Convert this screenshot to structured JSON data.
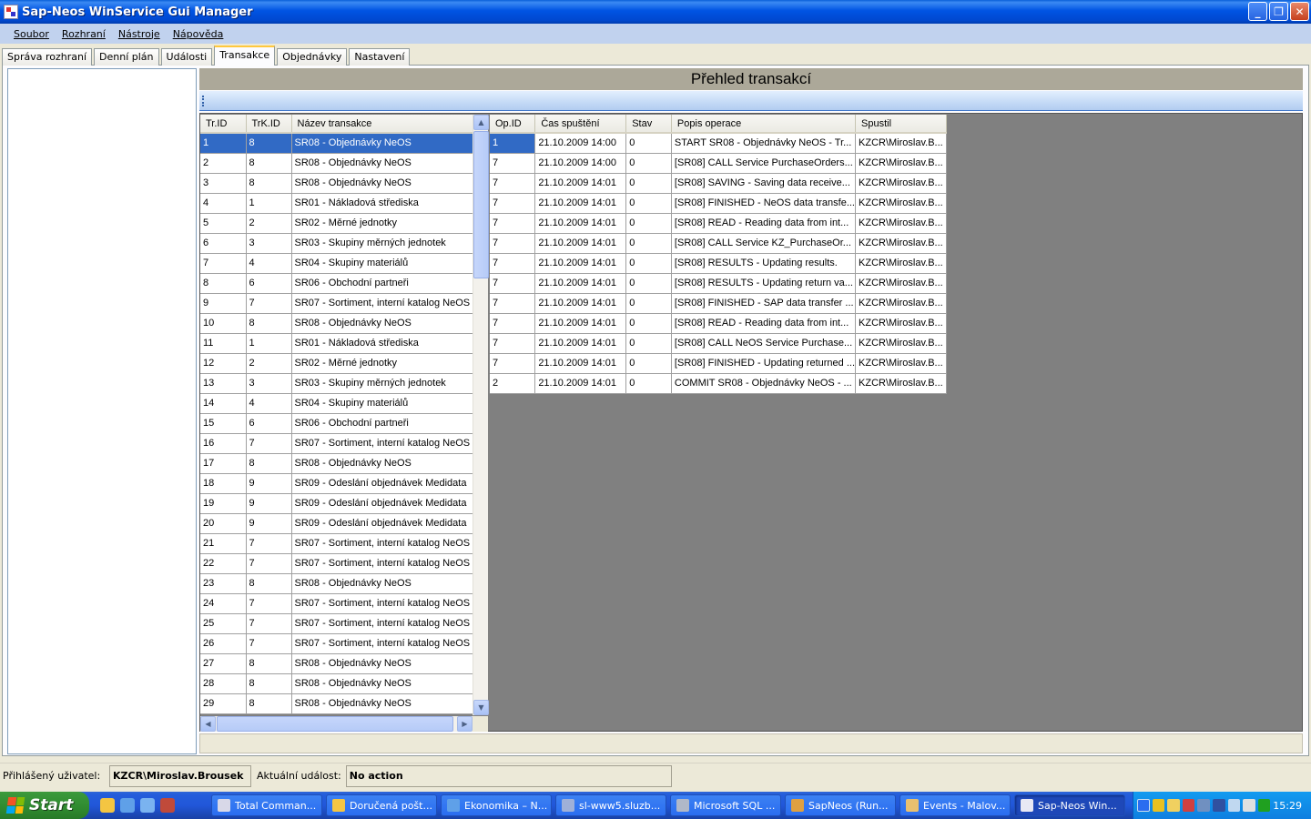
{
  "window": {
    "title": "Sap-Neos WinService Gui Manager"
  },
  "menu": [
    "Soubor",
    "Rozhraní",
    "Nástroje",
    "Nápověda"
  ],
  "tabs": [
    "Správa rozhraní",
    "Denní plán",
    "Události",
    "Transakce",
    "Objednávky",
    "Nastavení"
  ],
  "active_tab": "Transakce",
  "panel_title": "Přehled transakcí",
  "transactions": {
    "columns": [
      "Tr.ID",
      "TrK.ID",
      "Název transakce"
    ],
    "rows": [
      [
        "1",
        "8",
        "SR08 - Objednávky NeOS"
      ],
      [
        "2",
        "8",
        "SR08 - Objednávky NeOS"
      ],
      [
        "3",
        "8",
        "SR08 - Objednávky NeOS"
      ],
      [
        "4",
        "1",
        "SR01 - Nákladová střediska"
      ],
      [
        "5",
        "2",
        "SR02 - Měrné jednotky"
      ],
      [
        "6",
        "3",
        "SR03 - Skupiny měrných jednotek"
      ],
      [
        "7",
        "4",
        "SR04 - Skupiny materiálů"
      ],
      [
        "8",
        "6",
        "SR06 - Obchodní partneři"
      ],
      [
        "9",
        "7",
        "SR07 - Sortiment, interní katalog NeOS"
      ],
      [
        "10",
        "8",
        "SR08 - Objednávky NeOS"
      ],
      [
        "11",
        "1",
        "SR01 - Nákladová střediska"
      ],
      [
        "12",
        "2",
        "SR02 - Měrné jednotky"
      ],
      [
        "13",
        "3",
        "SR03 - Skupiny měrných jednotek"
      ],
      [
        "14",
        "4",
        "SR04 - Skupiny materiálů"
      ],
      [
        "15",
        "6",
        "SR06 - Obchodní partneři"
      ],
      [
        "16",
        "7",
        "SR07 - Sortiment, interní katalog NeOS"
      ],
      [
        "17",
        "8",
        "SR08 - Objednávky NeOS"
      ],
      [
        "18",
        "9",
        "SR09 - Odeslání objednávek Medidata"
      ],
      [
        "19",
        "9",
        "SR09 - Odeslání objednávek Medidata"
      ],
      [
        "20",
        "9",
        "SR09 - Odeslání objednávek Medidata"
      ],
      [
        "21",
        "7",
        "SR07 - Sortiment, interní katalog NeOS"
      ],
      [
        "22",
        "7",
        "SR07 - Sortiment, interní katalog NeOS"
      ],
      [
        "23",
        "8",
        "SR08 - Objednávky NeOS"
      ],
      [
        "24",
        "7",
        "SR07 - Sortiment, interní katalog NeOS"
      ],
      [
        "25",
        "7",
        "SR07 - Sortiment, interní katalog NeOS"
      ],
      [
        "26",
        "7",
        "SR07 - Sortiment, interní katalog NeOS"
      ],
      [
        "27",
        "8",
        "SR08 - Objednávky NeOS"
      ],
      [
        "28",
        "8",
        "SR08 - Objednávky NeOS"
      ],
      [
        "29",
        "8",
        "SR08 - Objednávky NeOS"
      ]
    ]
  },
  "operations": {
    "columns": [
      "Op.ID",
      "Čas spuštění",
      "Stav",
      "Popis operace",
      "Spustil"
    ],
    "rows": [
      [
        "1",
        "21.10.2009 14:00",
        "0",
        "START SR08 - Objednávky NeOS - Tr...",
        "KZCR\\Miroslav.B..."
      ],
      [
        "7",
        "21.10.2009 14:00",
        "0",
        "[SR08] CALL Service PurchaseOrders...",
        "KZCR\\Miroslav.B..."
      ],
      [
        "7",
        "21.10.2009 14:01",
        "0",
        "[SR08] SAVING - Saving data receive...",
        "KZCR\\Miroslav.B..."
      ],
      [
        "7",
        "21.10.2009 14:01",
        "0",
        "[SR08] FINISHED - NeOS data transfe...",
        "KZCR\\Miroslav.B..."
      ],
      [
        "7",
        "21.10.2009 14:01",
        "0",
        "[SR08] READ  - Reading data from int...",
        "KZCR\\Miroslav.B..."
      ],
      [
        "7",
        "21.10.2009 14:01",
        "0",
        "[SR08] CALL Service KZ_PurchaseOr...",
        "KZCR\\Miroslav.B..."
      ],
      [
        "7",
        "21.10.2009 14:01",
        "0",
        "[SR08] RESULTS - Updating results.",
        "KZCR\\Miroslav.B..."
      ],
      [
        "7",
        "21.10.2009 14:01",
        "0",
        "[SR08] RESULTS - Updating return va...",
        "KZCR\\Miroslav.B..."
      ],
      [
        "7",
        "21.10.2009 14:01",
        "0",
        "[SR08] FINISHED - SAP data transfer ...",
        "KZCR\\Miroslav.B..."
      ],
      [
        "7",
        "21.10.2009 14:01",
        "0",
        "[SR08] READ  - Reading data from int...",
        "KZCR\\Miroslav.B..."
      ],
      [
        "7",
        "21.10.2009 14:01",
        "0",
        "[SR08] CALL NeOS Service Purchase...",
        "KZCR\\Miroslav.B..."
      ],
      [
        "7",
        "21.10.2009 14:01",
        "0",
        "[SR08] FINISHED - Updating returned ...",
        "KZCR\\Miroslav.B..."
      ],
      [
        "2",
        "21.10.2009 14:01",
        "0",
        "COMMIT SR08 - Objednávky NeOS - ...",
        "KZCR\\Miroslav.B..."
      ]
    ]
  },
  "status": {
    "user_label": "Přihlášený uživatel:",
    "user_value": "KZCR\\Miroslav.Brousek",
    "event_label": "Aktuální událost:",
    "event_value": "No action"
  },
  "taskbar": {
    "start": "Start",
    "tasks": [
      "Total Comman...",
      "Doručená pošt...",
      "Ekonomika – N...",
      "sl-www5.sluzb...",
      "Microsoft SQL ...",
      "SapNeos (Run...",
      "Events - Malov...",
      "Sap-Neos Win..."
    ],
    "active_task": "Sap-Neos Win...",
    "clock": "15:29"
  },
  "colors": {
    "selection": "#316ac5",
    "title_bar": "#0054e3",
    "taskbar": "#245ddb",
    "start_button": "#2f8a2f"
  }
}
